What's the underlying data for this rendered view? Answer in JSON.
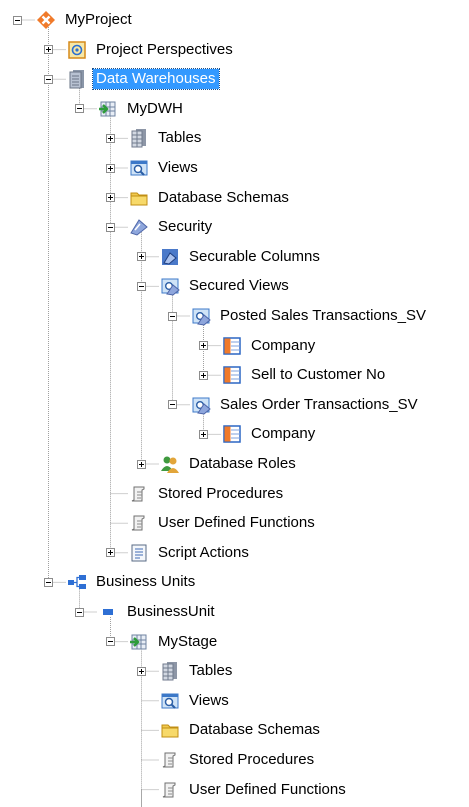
{
  "tree": [
    {
      "label": "MyProject",
      "depth": 0,
      "expander": "minus",
      "icon": "project-icon"
    },
    {
      "label": "Project Perspectives",
      "depth": 1,
      "expander": "plus",
      "icon": "perspective-icon"
    },
    {
      "label": "Data Warehouses",
      "depth": 1,
      "expander": "minus",
      "icon": "database-stack-icon",
      "selected": true
    },
    {
      "label": "MyDWH",
      "depth": 2,
      "expander": "minus",
      "icon": "dwh-icon"
    },
    {
      "label": "Tables",
      "depth": 3,
      "expander": "plus",
      "icon": "tables-icon"
    },
    {
      "label": "Views",
      "depth": 3,
      "expander": "plus",
      "icon": "views-icon"
    },
    {
      "label": "Database Schemas",
      "depth": 3,
      "expander": "plus",
      "icon": "folder-icon"
    },
    {
      "label": "Security",
      "depth": 3,
      "expander": "minus",
      "icon": "security-icon"
    },
    {
      "label": "Securable Columns",
      "depth": 4,
      "expander": "plus",
      "icon": "securable-columns-icon"
    },
    {
      "label": "Secured Views",
      "depth": 4,
      "expander": "minus",
      "icon": "secured-views-icon"
    },
    {
      "label": "Posted Sales Transactions_SV",
      "depth": 5,
      "expander": "minus",
      "icon": "secured-view-icon"
    },
    {
      "label": "Company",
      "depth": 6,
      "expander": "plus",
      "icon": "column-icon"
    },
    {
      "label": "Sell to Customer No",
      "depth": 6,
      "expander": "plus",
      "icon": "column-icon"
    },
    {
      "label": "Sales Order Transactions_SV",
      "depth": 5,
      "expander": "minus",
      "icon": "secured-view-icon"
    },
    {
      "label": "Company",
      "depth": 6,
      "expander": "plus",
      "icon": "column-icon"
    },
    {
      "label": "Database Roles",
      "depth": 4,
      "expander": "plus",
      "icon": "roles-icon"
    },
    {
      "label": "Stored Procedures",
      "depth": 3,
      "expander": null,
      "icon": "script-icon"
    },
    {
      "label": "User Defined Functions",
      "depth": 3,
      "expander": null,
      "icon": "script-icon"
    },
    {
      "label": "Script Actions",
      "depth": 3,
      "expander": "plus",
      "icon": "script-actions-icon"
    },
    {
      "label": "Business Units",
      "depth": 1,
      "expander": "minus",
      "icon": "business-units-icon"
    },
    {
      "label": "BusinessUnit",
      "depth": 2,
      "expander": "minus",
      "icon": "business-unit-icon"
    },
    {
      "label": "MyStage",
      "depth": 3,
      "expander": "minus",
      "icon": "stage-icon"
    },
    {
      "label": "Tables",
      "depth": 4,
      "expander": "plus",
      "icon": "tables-icon"
    },
    {
      "label": "Views",
      "depth": 4,
      "expander": null,
      "icon": "views-icon"
    },
    {
      "label": "Database Schemas",
      "depth": 4,
      "expander": null,
      "icon": "folder-icon"
    },
    {
      "label": "Stored Procedures",
      "depth": 4,
      "expander": null,
      "icon": "script-icon"
    },
    {
      "label": "User Defined Functions",
      "depth": 4,
      "expander": null,
      "icon": "script-icon"
    }
  ],
  "colors": {
    "selection": "#3399ff",
    "tree_line": "#a0a0a0"
  }
}
